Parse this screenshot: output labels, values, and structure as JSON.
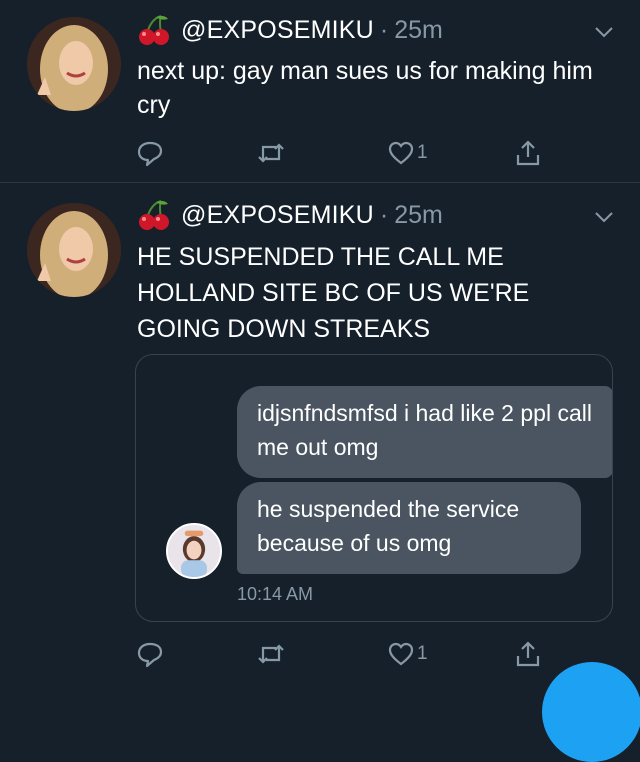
{
  "colors": {
    "background": "#15202b",
    "secondary_text": "#8899a6",
    "bubble": "#4a5561",
    "accent": "#1da1f2"
  },
  "tweets": [
    {
      "handle": "@EXPOSEMIKU",
      "separator": "·",
      "time": "25m",
      "text": "next up: gay man sues us for making him cry",
      "like_count": "1",
      "icons": [
        "reply-icon",
        "retweet-icon",
        "like-icon",
        "share-icon"
      ]
    },
    {
      "handle": "@EXPOSEMIKU",
      "separator": "·",
      "time": "25m",
      "text": "HE SUSPENDED THE CALL ME HOLLAND SITE BC OF US WE'RE GOING DOWN STREAKS",
      "like_count": "1",
      "icons": [
        "reply-icon",
        "retweet-icon",
        "like-icon",
        "share-icon"
      ],
      "embedded_chat": {
        "messages": [
          "idjsnfndsmfsd i had like 2 ppl call me out omg",
          "he suspended the service because of us omg"
        ],
        "timestamp": "10:14 AM"
      }
    }
  ]
}
